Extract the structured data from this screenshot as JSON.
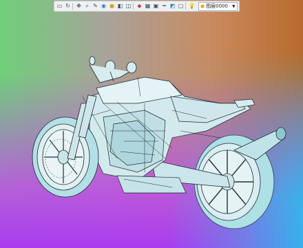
{
  "toolbar": {
    "icons": [
      "select-icon",
      "rotate-icon",
      "pan-icon",
      "zoom-icon",
      "sketch-icon",
      "render-icon",
      "sphere-icon",
      "cube-icon",
      "section-icon",
      "color-icon",
      "grid-icon",
      "view-icon",
      "measure-icon",
      "palette-icon",
      "light-icon",
      "layer-icon"
    ],
    "layer_select": {
      "value": "图层0000"
    }
  },
  "viewport": {
    "background_colors": [
      "#6fcf7a",
      "#c98a60",
      "#b86a2c",
      "#b34fe8",
      "#2fbde8"
    ],
    "model": "motorcycle-wireframe"
  }
}
